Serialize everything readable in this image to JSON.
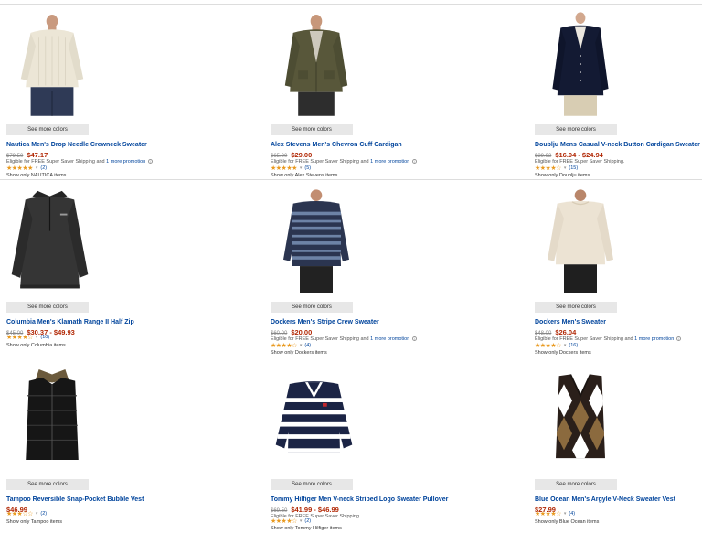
{
  "see_more_label": "See more colors",
  "products": [
    {
      "title": "Nautica Men's Drop Needle Crewneck Sweater",
      "list_price": "$79.50",
      "price": "$47.17",
      "shipping": "Eligible for FREE Super Saver Shipping and",
      "promo": "1 more promotion",
      "stars": "★★★★★",
      "rating": 5.0,
      "count": "(2)",
      "show_only": "Show only NAUTICA items"
    },
    {
      "title": "Alex Stevens Men's Chevron Cuff Cardigan",
      "list_price": "$65.00",
      "price": "$29.00",
      "shipping": "Eligible for FREE Super Saver Shipping and",
      "promo": "1 more promotion",
      "stars": "★★★★★",
      "rating": 5.0,
      "count": "(5)",
      "show_only": "Show only Alex Stevens items"
    },
    {
      "title": "Doublju Mens Casual V-neck Button Cardigan Sweater",
      "list_price": "$39.92",
      "price": "$16.94 - $24.94",
      "shipping": "Eligible for FREE Super Saver Shipping.",
      "promo": "",
      "stars": "★★★★☆",
      "rating": 4.0,
      "count": "(15)",
      "show_only": "Show only Doublju items"
    },
    {
      "title": "Columbia Men's Klamath Range II Half Zip",
      "list_price": "$45.00",
      "price": "$30.37 - $49.93",
      "shipping": "",
      "promo": "",
      "stars": "★★★★☆",
      "rating": 4.5,
      "count": "(10)",
      "show_only": "Show only Columbia items"
    },
    {
      "title": "Dockers Men's Stripe Crew Sweater",
      "list_price": "$60.00",
      "price": "$20.00",
      "shipping": "Eligible for FREE Super Saver Shipping and",
      "promo": "1 more promotion",
      "stars": "★★★★☆",
      "rating": 4.5,
      "count": "(4)",
      "show_only": "Show only Dockers items"
    },
    {
      "title": "Dockers Men's Sweater",
      "list_price": "$48.00",
      "price": "$26.04",
      "shipping": "Eligible for FREE Super Saver Shipping and",
      "promo": "1 more promotion",
      "stars": "★★★★☆",
      "rating": 4.5,
      "count": "(16)",
      "show_only": "Show only Dockers items"
    },
    {
      "title": "Tampoo Reversible Snap-Pocket Bubble Vest",
      "list_price": "",
      "price": "$46.99",
      "shipping": "",
      "promo": "",
      "stars": "★★★☆☆",
      "rating": 3.5,
      "count": "(2)",
      "show_only": "Show only Tampoo items"
    },
    {
      "title": "Tommy Hilfiger Men V-neck Striped Logo Sweater Pullover",
      "list_price": "$69.50",
      "price": "$41.99 - $46.99",
      "shipping": "Eligible for FREE Super Saver Shipping.",
      "promo": "",
      "stars": "★★★★☆",
      "rating": 4.5,
      "count": "(2)",
      "show_only": "Show only Tommy Hilfiger items"
    },
    {
      "title": "Blue Ocean Men's Argyle V-Neck Sweater Vest",
      "list_price": "",
      "price": "$27.99",
      "shipping": "",
      "promo": "",
      "stars": "★★★★☆",
      "rating": 4.5,
      "count": "(4)",
      "show_only": "Show only Blue Ocean items"
    }
  ]
}
